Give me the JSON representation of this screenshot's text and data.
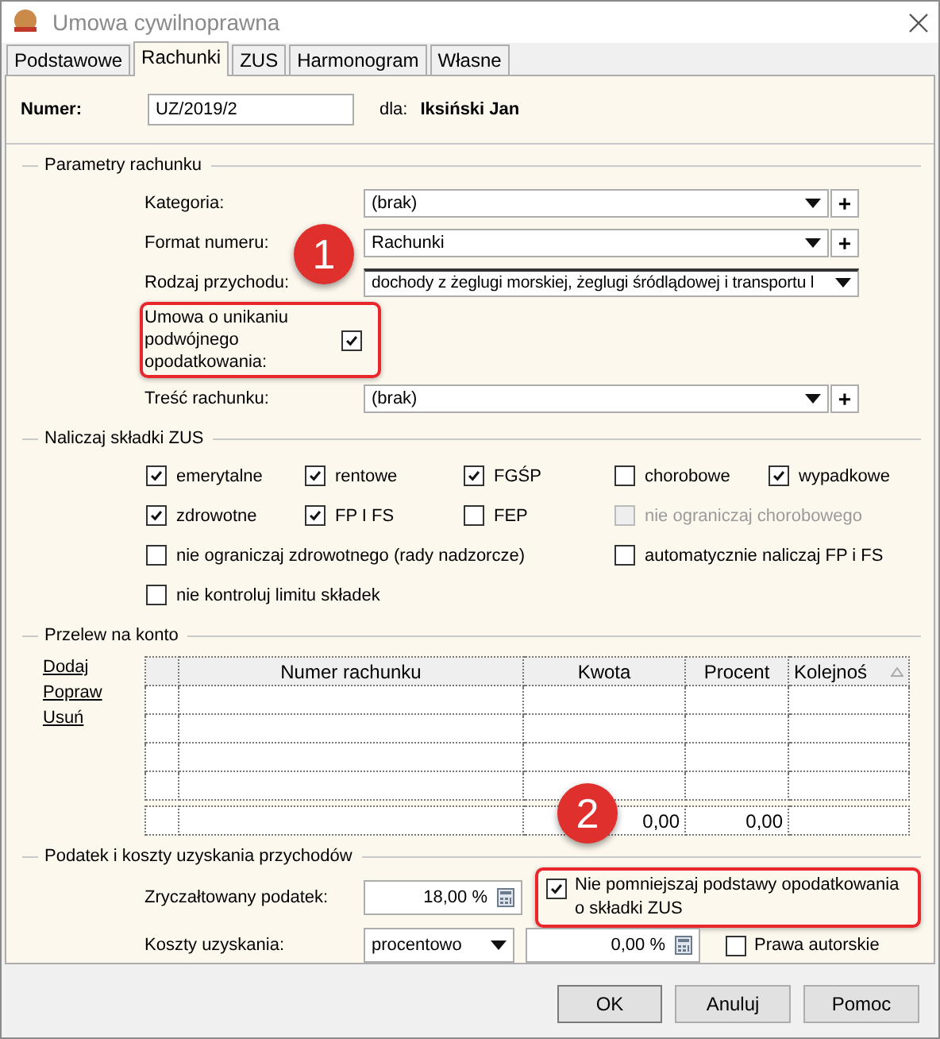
{
  "window": {
    "title": "Umowa cywilnoprawna"
  },
  "tabs": [
    {
      "label": "Podstawowe",
      "selected": false
    },
    {
      "label": "Rachunki",
      "selected": true
    },
    {
      "label": "ZUS",
      "selected": false
    },
    {
      "label": "Harmonogram",
      "selected": false
    },
    {
      "label": "Własne",
      "selected": false
    }
  ],
  "header": {
    "label": "Numer:",
    "value": "UZ/2019/2",
    "for_label": "dla:",
    "for_value": "Iksiński Jan"
  },
  "parameters": {
    "title": "Parametry rachunku",
    "rows": [
      {
        "kind": "combo",
        "label": "Kategoria:",
        "value": "(brak)",
        "add": "+"
      },
      {
        "kind": "combo",
        "label": "Format numeru:",
        "value": "Rachunki",
        "add": "+"
      },
      {
        "kind": "select",
        "label": "Rodzaj przychodu:",
        "value": "dochody z żeglugi morskiej, żeglugi śródlądowej i transportu l"
      },
      {
        "kind": "check",
        "label": "Umowa o unikaniu podwójnego opodatkowania:",
        "checked": true,
        "highlighted": true
      },
      {
        "kind": "combo",
        "label": "Treść rachunku:",
        "value": "(brak)",
        "add": "+"
      }
    ]
  },
  "zus": {
    "title": "Naliczaj składki ZUS",
    "rows": [
      {
        "left": [
          {
            "label": "emerytalne",
            "checked": true,
            "disabled": false
          },
          {
            "label": "rentowe",
            "checked": true,
            "disabled": false
          },
          {
            "label": "FGŚP",
            "checked": true,
            "disabled": false
          }
        ],
        "right": [
          {
            "label": "chorobowe",
            "checked": false,
            "disabled": false
          },
          {
            "label": "wypadkowe",
            "checked": true,
            "disabled": false
          }
        ]
      },
      {
        "left": [
          {
            "label": "zdrowotne",
            "checked": true,
            "disabled": false
          },
          {
            "label": "FP I FS",
            "checked": true,
            "disabled": false
          },
          {
            "label": "FEP",
            "checked": false,
            "disabled": false
          }
        ],
        "right": [
          {
            "label": "nie ograniczaj chorobowego",
            "checked": false,
            "disabled": true
          }
        ]
      },
      {
        "left": [
          {
            "label": "nie ograniczaj zdrowotnego (rady nadzorcze)",
            "checked": false,
            "disabled": false
          }
        ],
        "right": [
          {
            "label": "automatycznie naliczaj FP i FS",
            "checked": false,
            "disabled": false
          }
        ]
      },
      {
        "left": [
          {
            "label": "nie kontroluj limitu składek",
            "checked": false,
            "disabled": false
          }
        ],
        "right": []
      }
    ]
  },
  "transfer": {
    "title": "Przelew na konto",
    "links": [
      "Dodaj",
      "Popraw",
      "Usuń"
    ],
    "table": {
      "columns": [
        "Numer rachunku",
        "Kwota",
        "Procent",
        "Kolejnoś"
      ],
      "totals": {
        "amount": "0,00",
        "percent": "0,00"
      }
    }
  },
  "tax": {
    "title": "Podatek i koszty uzyskania przychodów",
    "flat_tax": {
      "label": "Zryczałtowany podatek:",
      "value": "18,00 %"
    },
    "no_reduce": {
      "label": "Nie pomniejszaj podstawy opodatkowania o składki ZUS",
      "checked": true,
      "highlighted": true
    },
    "costs": {
      "label": "Koszty uzyskania:",
      "mode": "procentowo",
      "value": "0,00 %"
    },
    "copyright": {
      "label": "Prawa autorskie",
      "checked": false
    }
  },
  "buttons": [
    {
      "label": "OK",
      "default": true
    },
    {
      "label": "Anuluj",
      "default": false
    },
    {
      "label": "Pomoc",
      "default": false
    }
  ],
  "callouts": [
    "1",
    "2"
  ]
}
